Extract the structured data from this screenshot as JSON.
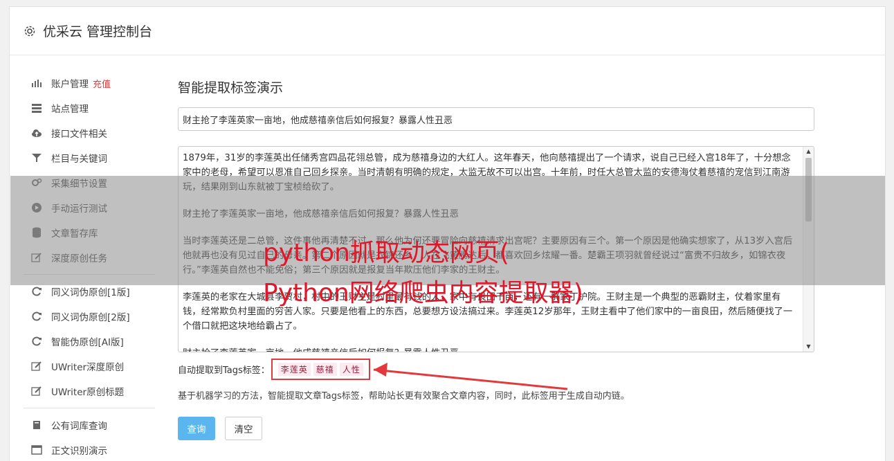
{
  "header": {
    "title": "优采云 管理控制台",
    "icon": "gear-icon"
  },
  "sidebar": {
    "group1": [
      {
        "icon": "bar-chart-icon",
        "label": "账户管理",
        "badge": "充值"
      },
      {
        "icon": "server-icon",
        "label": "站点管理"
      },
      {
        "icon": "cloud-upload-icon",
        "label": "接口文件相关"
      },
      {
        "icon": "filter-icon",
        "label": "栏目与关键词"
      },
      {
        "icon": "gears-icon",
        "label": "采集细节设置"
      },
      {
        "icon": "play-circle-icon",
        "label": "手动运行测试"
      },
      {
        "icon": "database-icon",
        "label": "文章暂存库"
      },
      {
        "icon": "edit-icon",
        "label": "深度原创任务"
      }
    ],
    "group2": [
      {
        "icon": "refresh-icon",
        "label": "同义词伪原创[1版]"
      },
      {
        "icon": "refresh-icon",
        "label": "同义词伪原创[2版]"
      },
      {
        "icon": "refresh-icon",
        "label": "智能伪原创[AI版]"
      },
      {
        "icon": "edit-icon",
        "label": "UWriter深度原创"
      },
      {
        "icon": "edit-icon",
        "label": "UWriter原创标题"
      }
    ],
    "group3": [
      {
        "icon": "book-icon",
        "label": "公有词库查询"
      },
      {
        "icon": "window-icon",
        "label": "正文识别演示"
      }
    ]
  },
  "main": {
    "heading": "智能提取标签演示",
    "title_value": "财主抢了李莲英家一亩地，他成慈禧亲信后如何报复？暴露人性丑恶",
    "paragraphs": [
      "1879年，31岁的李莲英出任储秀宫四品花翎总管，成为慈禧身边的大红人。这年春天，他向慈禧提出了一个请求，说自己已经入宫18年了，十分想念家中的老母，希望可以恩准自己回乡探亲。当时清朝有明确的规定，太监无故不可以出宫。十年前，时任大总管太监的安德海仗着慈禧的宠信到江南游玩，结果刚到山东就被丁宝桢给砍了。",
      "财主抢了李莲英家一亩地，他成慈禧亲信后如何报复？暴露人性丑恶",
      "当时李莲英还是二总管，这件事他再清楚不过，那么他为何还要冒险向慈禧请求出宫呢？主要原因有三个。第一个原因是他确实想家了，从13岁入宫后他就再也没有见过自己的母亲。第二个原因就是衣锦还乡，人在飞黄腾达后，都喜欢回乡炫耀一番。楚霸王项羽就曾经说过“富贵不归故乡，如锦衣夜行。”李莲英自然也不能免俗；第三个原因就是报复当年欺压他们李家的王财主。",
      "李莲英的老家在大城县李贾村，村中的王财主是村里最有钱的人，家中有良田千亩，还有一群家丁护院。王财主是一个典型的恶霸财主，仗着家里有钱，经常欺负村里面的穷苦人家。只要是他看上的东西，总要想方设法搞过来。李莲英12岁那年，王财主看中了他们家中的一亩良田，然后随便找了一个借口就把这块地给霸占了。",
      "财主抢了李莲英家一亩地，他成慈禧亲信后如何报复？暴露人性丑恶"
    ],
    "tags_label": "自动提取到Tags标签：",
    "tags": [
      "李莲英",
      "慈禧",
      "人性"
    ],
    "description": "基于机器学习的方法，智能提取文章Tags标签，帮助站长更有效聚合文章内容，同时，此标签用于生成自动内链。",
    "query_button": "查询",
    "clear_button": "清空"
  },
  "overlay": {
    "line1": "python抓取动态网页(",
    "line2": "Python网络爬虫内容提取器)"
  },
  "colors": {
    "accent": "#5bb5ef",
    "tag_border": "#e4393c",
    "overlay_text": "#e0172a"
  }
}
